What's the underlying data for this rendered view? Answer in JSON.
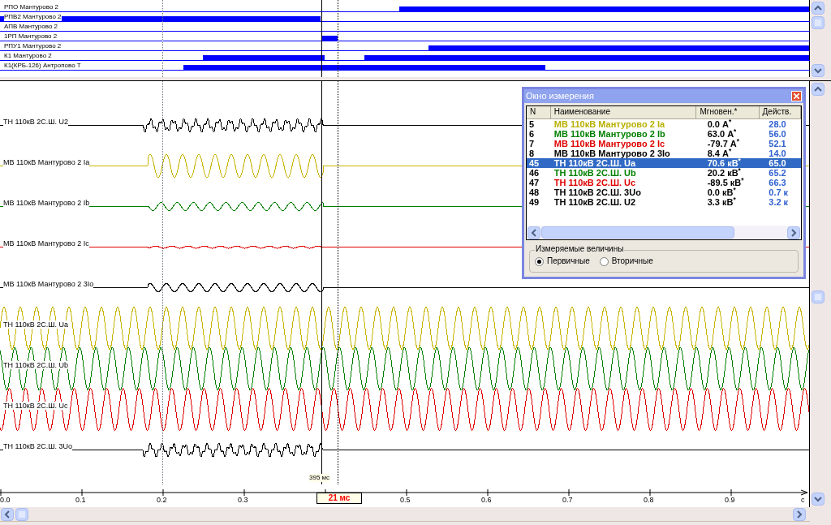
{
  "digital_channels": [
    {
      "label": "РПО  Мантурово 2"
    },
    {
      "label": "РПВ2 Мантурово 2"
    },
    {
      "label": "АПВ Мантурово 2"
    },
    {
      "label": "1РП Мантурово 2"
    },
    {
      "label": "РПУ1 Мантурово 2"
    },
    {
      "label": "К1 Мантурово 2"
    },
    {
      "label": "К1(КРБ-126) Антропово Т"
    }
  ],
  "analog_channels": [
    {
      "label": "ТН 110кВ 2С.Ш. U2",
      "color": "#000000",
      "kind": "noise"
    },
    {
      "label": "МВ 110кВ Мантурово 2 Ia",
      "color": "#c8b400",
      "kind": "burst"
    },
    {
      "label": "МВ 110кВ Мантурово 2 Ib",
      "color": "#008000",
      "kind": "weak"
    },
    {
      "label": "МВ 110кВ Мантурово 2 Ic",
      "color": "#e00000",
      "kind": "flat"
    },
    {
      "label": "МВ 110кВ Мантурово 2 3Io",
      "color": "#000000",
      "kind": "weak"
    },
    {
      "label": "ТН 110кВ 2С.Ш. Ua",
      "color": "#c8b400",
      "kind": "continuous"
    },
    {
      "label": "ТН 110кВ 2С.Ш. Ub",
      "color": "#008000",
      "kind": "continuous"
    },
    {
      "label": "ТН 110кВ 2С.Ш. Uc",
      "color": "#e00000",
      "kind": "continuous"
    },
    {
      "label": "ТН 110кВ 2С.Ш. 3Uo",
      "color": "#000000",
      "kind": "noise"
    }
  ],
  "time_axis": {
    "ticks_before_cursor": [
      "0.0",
      "0.1",
      "0.2",
      "0.3"
    ],
    "ticks_after_cursor": [
      "0.5",
      "0.6",
      "0.7",
      "0.8",
      "0.9"
    ],
    "unit": "c"
  },
  "cursors": {
    "position_label": "395 мс",
    "delta_label": "21 мс"
  },
  "measurement_window": {
    "title": "Окно измерения",
    "columns": [
      "N",
      "Наименование",
      "Мгновен.*",
      "Действ."
    ],
    "rows": [
      {
        "n": "5",
        "name": "МВ 110кВ Мантурово 2 Ia",
        "color": "#b8b000",
        "instant": "0.0",
        "unit": "А$^{*}$",
        "rms": "28.0",
        "selected": false
      },
      {
        "n": "6",
        "name": "МВ 110кВ Мантурово 2 Ib",
        "color": "#008000",
        "instant": "63.0",
        "unit": "А$^{*}$",
        "rms": "56.0",
        "selected": false
      },
      {
        "n": "7",
        "name": "МВ 110кВ Мантурово 2 Ic",
        "color": "#e00000",
        "instant": "-79.7",
        "unit": "А$^{*}$",
        "rms": "52.1",
        "selected": false
      },
      {
        "n": "8",
        "name": "МВ 110кВ Мантурово 2 3Io",
        "color": "#000000",
        "instant": "8.4",
        "unit": "А$^{*}$",
        "rms": "14.0",
        "selected": false
      },
      {
        "n": "45",
        "name": "ТН 110кВ 2С.Ш. Ua",
        "instant": "70.6",
        "unit": "кВ$^{*}$",
        "rms": "65.0",
        "selected": true
      },
      {
        "n": "46",
        "name": "ТН 110кВ 2С.Ш. Ub",
        "color": "#008000",
        "instant": "20.2",
        "unit": "кВ$^{*}$",
        "rms": "65.2",
        "selected": false
      },
      {
        "n": "47",
        "name": "ТН 110кВ 2С.Ш. Uc",
        "color": "#e00000",
        "instant": "-89.5",
        "unit": "кВ$^{*}$",
        "rms": "66.3",
        "selected": false
      },
      {
        "n": "48",
        "name": "ТН 110кВ 2С.Ш. 3Uo",
        "color": "#000000",
        "instant": "0.0",
        "unit": "кВ$^{*}$",
        "rms": "0.7  к",
        "selected": false
      },
      {
        "n": "49",
        "name": "ТН 110кВ 2С.Ш. U2",
        "color": "#000000",
        "instant": "3.3",
        "unit": "кВ$^{*}$",
        "rms": "3.2  к",
        "selected": false
      }
    ],
    "group": {
      "title": "Измеряемые величины",
      "options": [
        {
          "label": "Первичные",
          "selected": true
        },
        {
          "label": "Вторичные",
          "selected": false
        }
      ]
    }
  }
}
